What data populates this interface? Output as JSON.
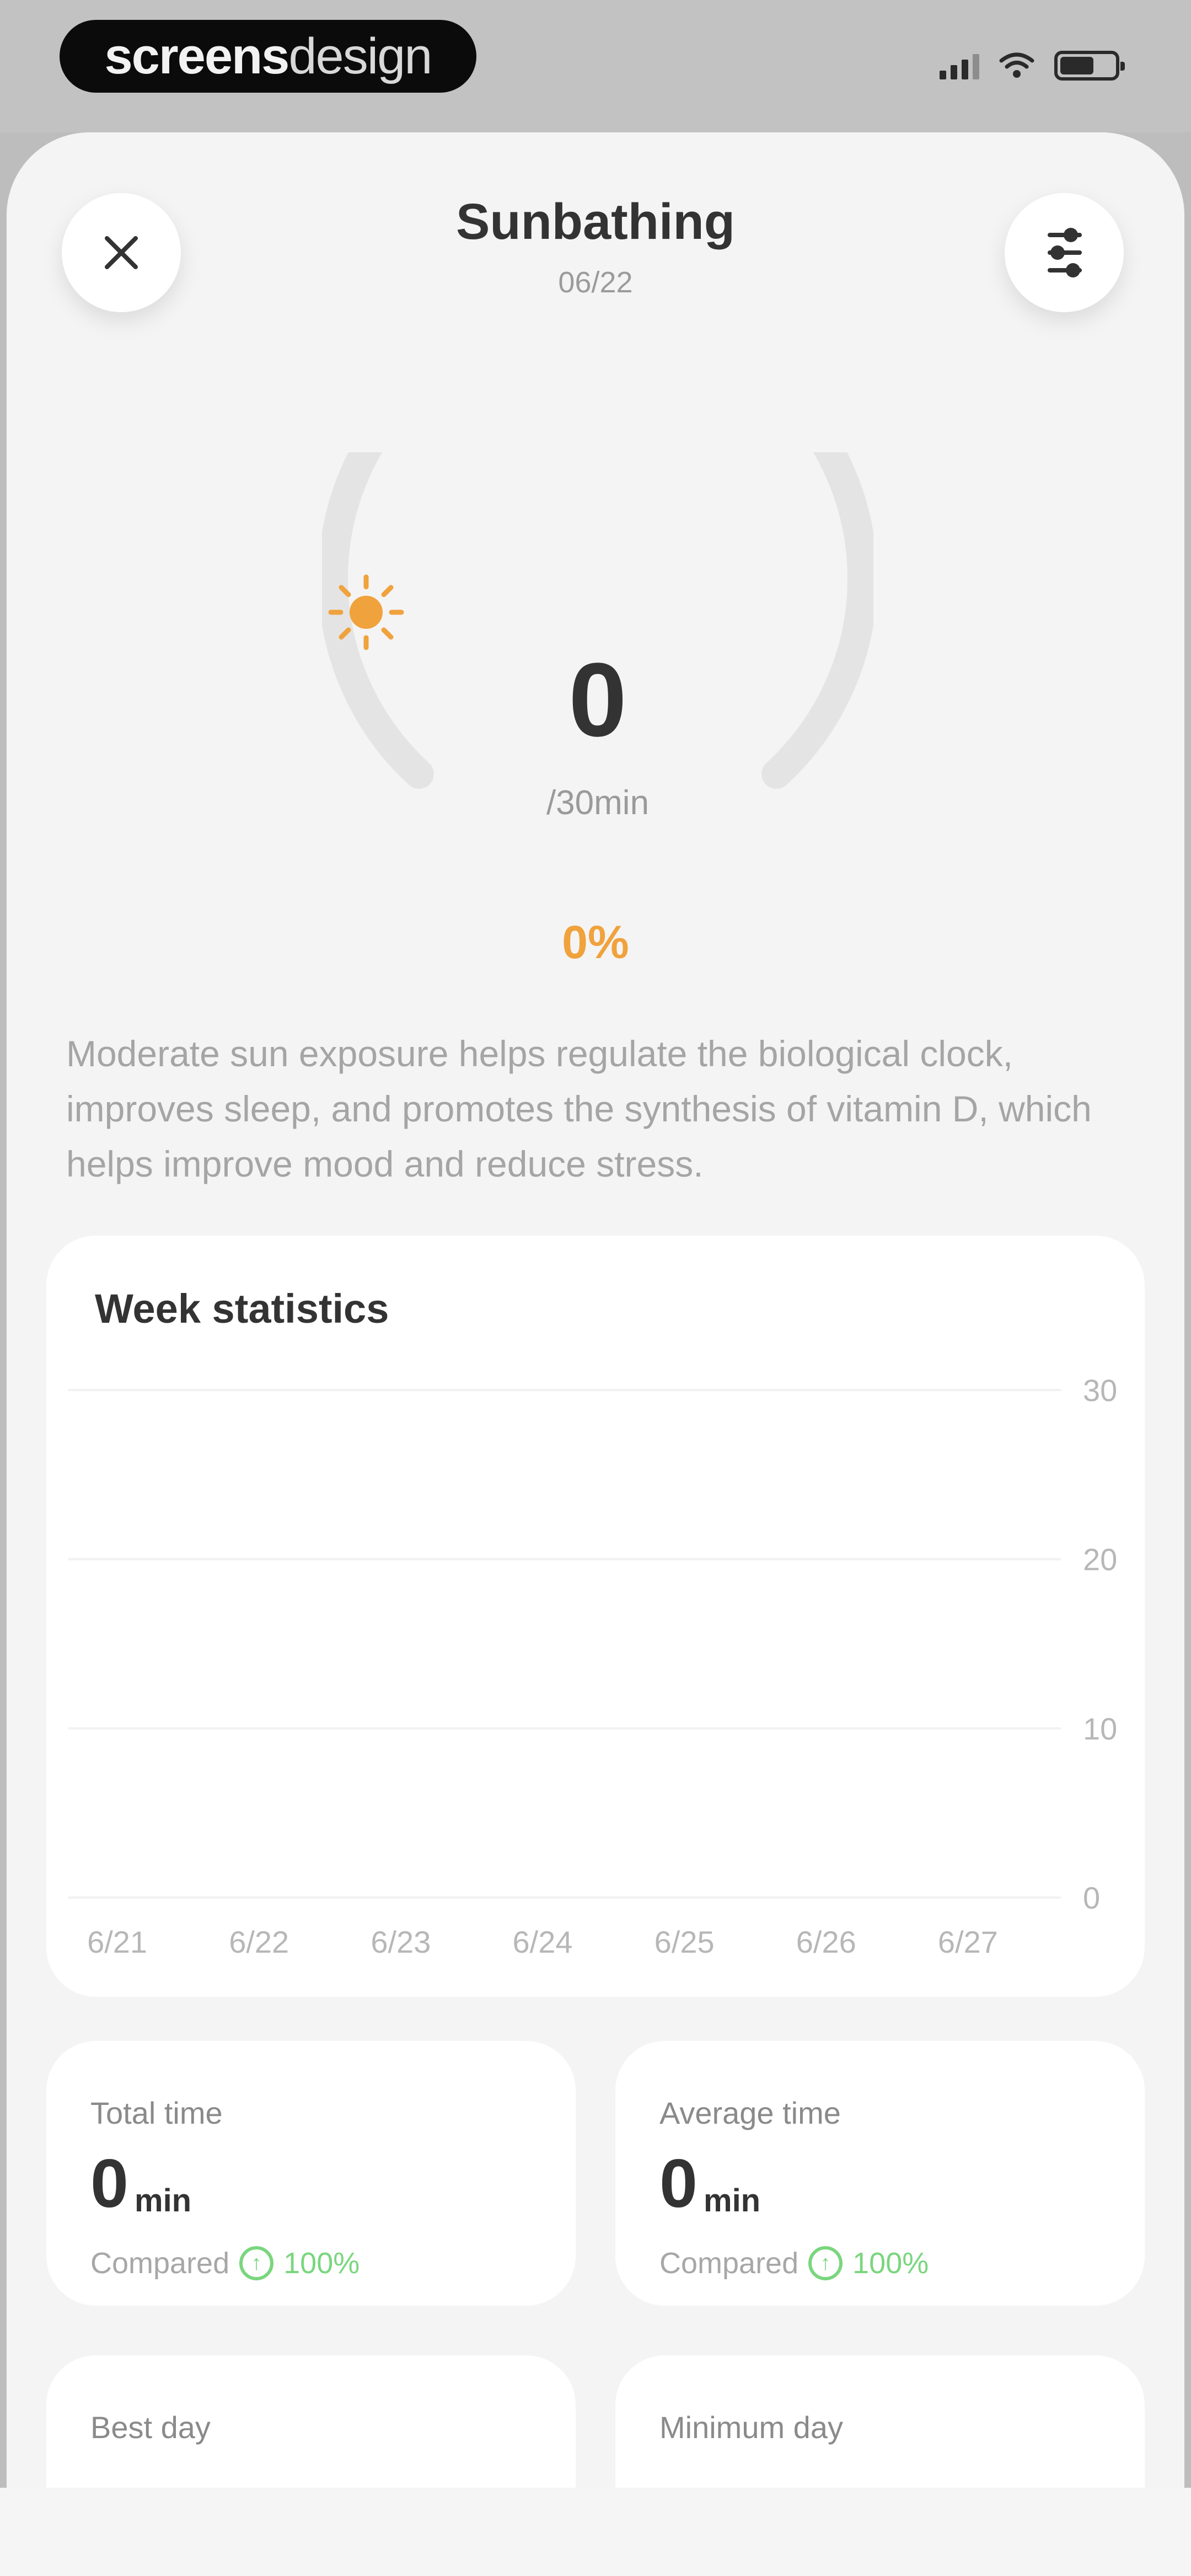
{
  "brand": {
    "part1": "screens",
    "part2": "design"
  },
  "header": {
    "title": "Sunbathing",
    "date": "06/22"
  },
  "gauge": {
    "value": "0",
    "goal": "/30min",
    "percent": "0%",
    "progress_fraction": 0,
    "accent_color": "#f0a23c"
  },
  "description": "Moderate sun exposure helps regulate the biological clock, improves sleep, and promotes the synthesis of vitamin D, which helps improve mood and reduce stress.",
  "week": {
    "title": "Week statistics"
  },
  "chart_data": {
    "type": "bar",
    "categories": [
      "6/21",
      "6/22",
      "6/23",
      "6/24",
      "6/25",
      "6/26",
      "6/27"
    ],
    "values": [
      0,
      0,
      0,
      0,
      0,
      0,
      0
    ],
    "ylim": [
      0,
      30
    ],
    "y_ticks": [
      "30",
      "20",
      "10",
      "0"
    ],
    "grid": true
  },
  "stats": [
    {
      "label": "Total time",
      "value": "0",
      "unit": "min",
      "compare_label": "Compared",
      "compare_value": "100%",
      "compare_icon": "up-arrow-circle-icon"
    },
    {
      "label": "Average time",
      "value": "0",
      "unit": "min",
      "compare_label": "Compared",
      "compare_value": "100%",
      "compare_icon": "up-arrow-circle-icon"
    },
    {
      "label": "Best day"
    },
    {
      "label": "Minimum day"
    }
  ],
  "icons": {
    "close": "close-icon",
    "settings": "sliders-icon",
    "sun": "sun-icon"
  },
  "colors": {
    "accent": "#f0a23c",
    "positive": "#7ad67e",
    "background": "#f4f4f4"
  }
}
